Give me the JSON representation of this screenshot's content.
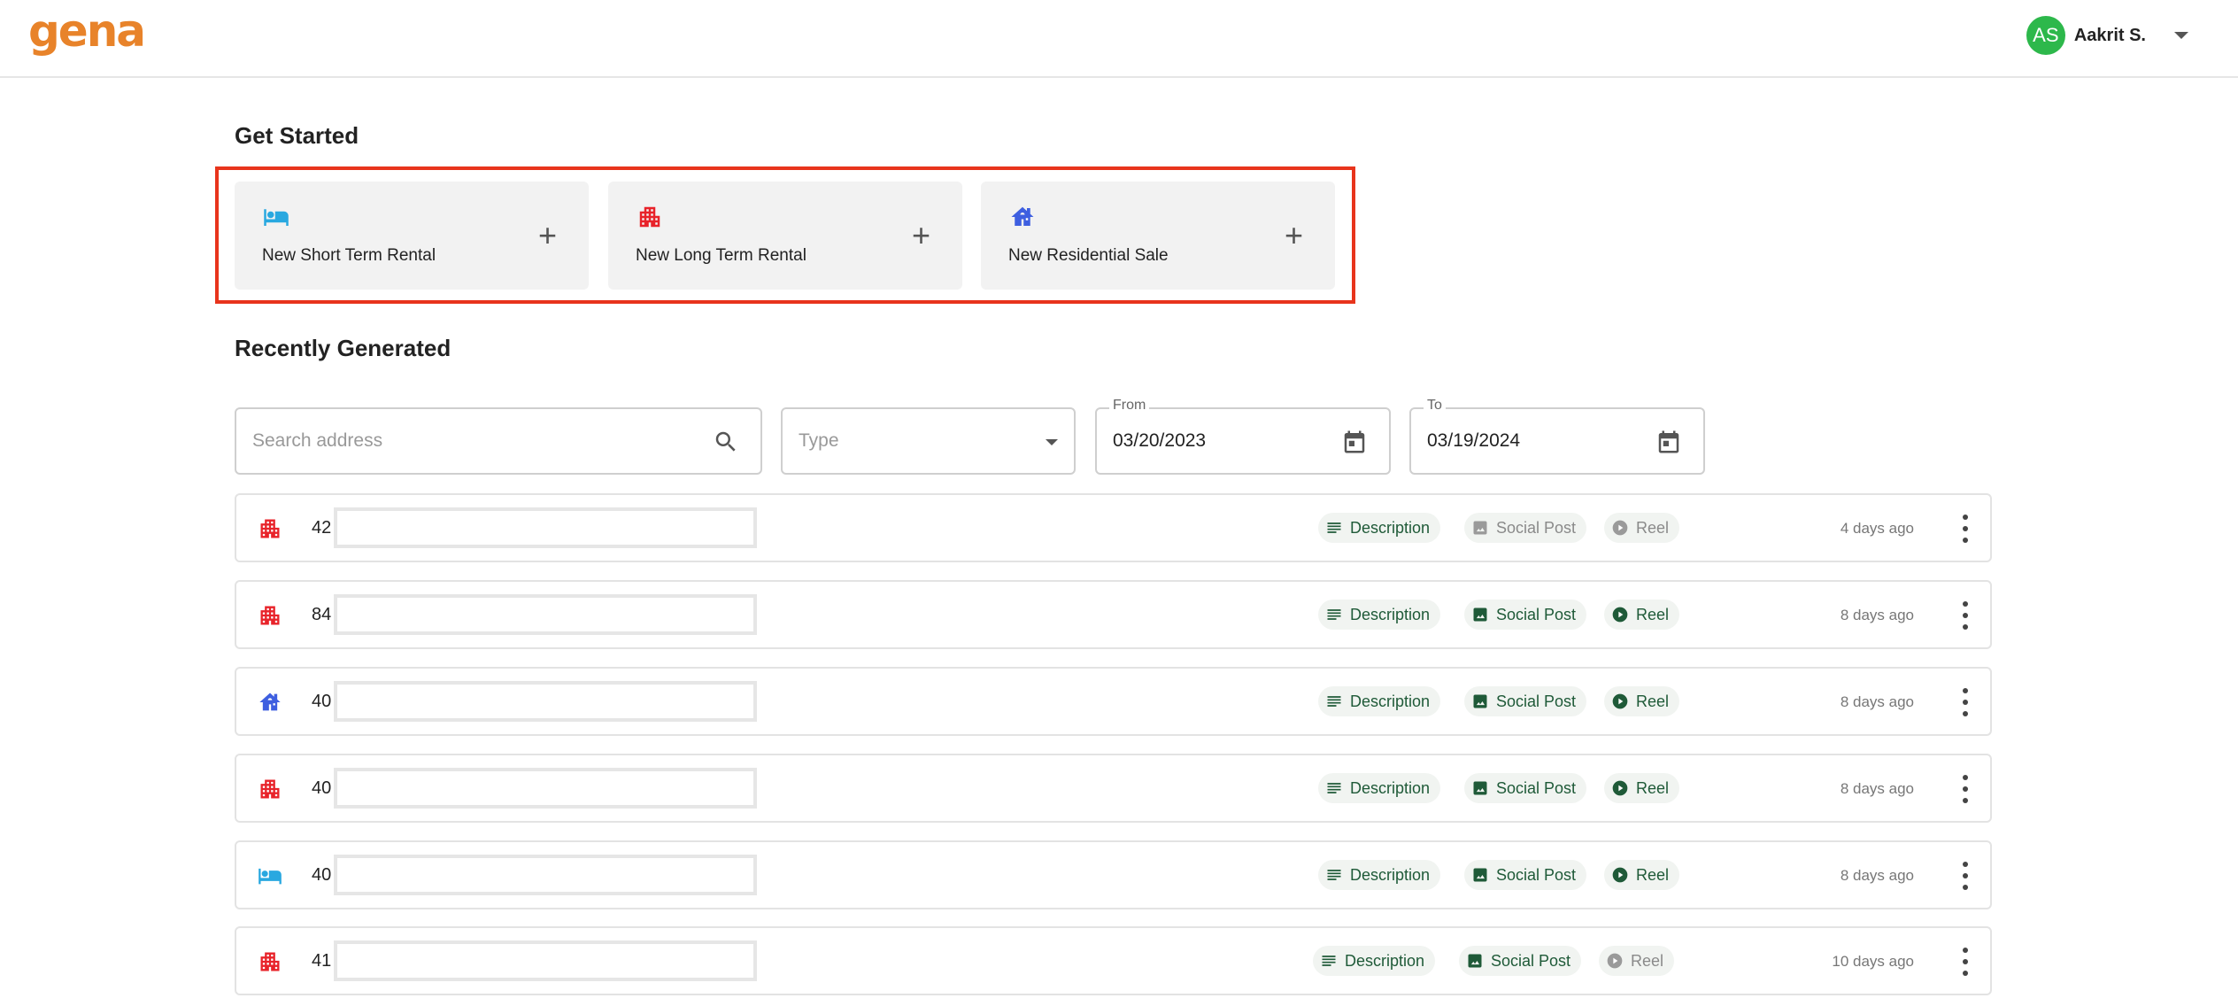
{
  "header": {
    "logo": "gena",
    "user": {
      "initials": "AS",
      "name": "Aakrit S."
    }
  },
  "get_started": {
    "title": "Get Started",
    "cards": [
      {
        "label": "New Short Term Rental",
        "icon": "bed-icon",
        "color": "#29a8e0"
      },
      {
        "label": "New Long Term Rental",
        "icon": "apartment-icon",
        "color": "#e8232a"
      },
      {
        "label": "New Residential Sale",
        "icon": "house-icon",
        "color": "#3e5fe0"
      }
    ]
  },
  "recent": {
    "title": "Recently Generated",
    "filters": {
      "search_placeholder": "Search address",
      "type_placeholder": "Type",
      "from_label": "From",
      "from_value": "03/20/2023",
      "to_label": "To",
      "to_value": "03/19/2024"
    },
    "chip_labels": {
      "description": "Description",
      "social": "Social Post",
      "reel": "Reel"
    },
    "rows": [
      {
        "num": "42",
        "icon": "apartment-icon",
        "ago": "4 days ago",
        "social_enabled": false,
        "reel_enabled": false
      },
      {
        "num": "84",
        "icon": "apartment-icon",
        "ago": "8 days ago",
        "social_enabled": true,
        "reel_enabled": true
      },
      {
        "num": "40",
        "icon": "house-icon",
        "ago": "8 days ago",
        "social_enabled": true,
        "reel_enabled": true
      },
      {
        "num": "40",
        "icon": "apartment-icon",
        "ago": "8 days ago",
        "social_enabled": true,
        "reel_enabled": true
      },
      {
        "num": "40",
        "icon": "bed-icon",
        "ago": "8 days ago",
        "social_enabled": true,
        "reel_enabled": true
      },
      {
        "num": "41",
        "icon": "apartment-icon",
        "ago": "10 days ago",
        "social_enabled": true,
        "reel_enabled": false
      }
    ]
  },
  "colors": {
    "accent": "#e8832a",
    "bed": "#29a8e0",
    "apartment": "#e8232a",
    "house": "#3e5fe0",
    "chip_text": "#1f5a38"
  }
}
